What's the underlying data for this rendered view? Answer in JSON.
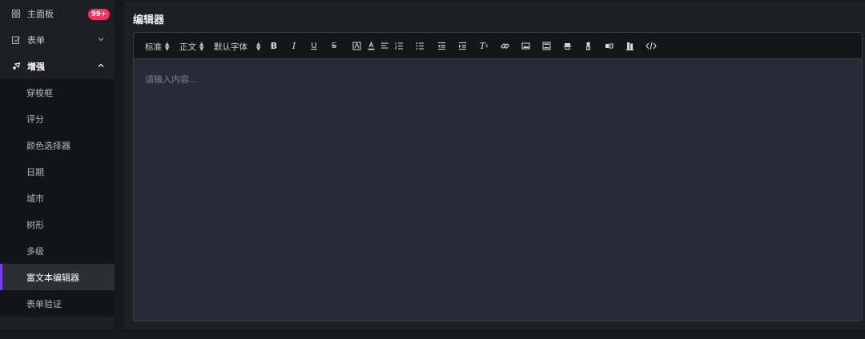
{
  "sidebar": {
    "items": [
      {
        "label": "主面板",
        "icon": "dashboard-icon",
        "badge": "99+"
      },
      {
        "label": "表单",
        "icon": "form-icon",
        "arrow": "chevron-down-icon"
      },
      {
        "label": "增强",
        "icon": "enhance-icon",
        "arrow": "chevron-up-icon"
      }
    ],
    "submenu": [
      {
        "label": "穿梭框"
      },
      {
        "label": "评分"
      },
      {
        "label": "颜色选择器"
      },
      {
        "label": "日期"
      },
      {
        "label": "城市"
      },
      {
        "label": "树形"
      },
      {
        "label": "多级"
      },
      {
        "label": "富文本编辑器",
        "active": true
      },
      {
        "label": "表单验证"
      }
    ],
    "accent_color": "#7b3ff2",
    "badge_color": "#f5345f"
  },
  "main": {
    "title": "编辑器",
    "editor": {
      "toolbar": {
        "size_select": "标准",
        "header_select": "正文",
        "font_select": "默认字体",
        "buttons": [
          "bold-icon",
          "italic-icon",
          "underline-icon",
          "strike-icon",
          "background-color-icon",
          "font-color-icon",
          "align-icon",
          "ordered-list-icon",
          "bullet-list-icon",
          "outdent-icon",
          "indent-icon",
          "clean-format-icon",
          "link-icon",
          "image-icon",
          "video-icon",
          "table-icon",
          "insert-row-icon",
          "insert-column-icon",
          "delete-row-icon",
          "code-icon"
        ]
      },
      "placeholder": "请输入内容..."
    }
  }
}
